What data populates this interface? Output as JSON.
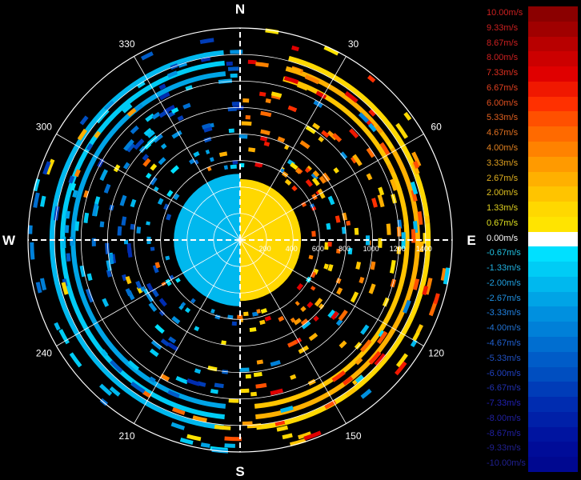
{
  "chart_data": {
    "type": "polar-radial-velocity",
    "title": "",
    "cardinals": {
      "north": "N",
      "east": "E",
      "south": "S",
      "west": "W"
    },
    "angle_ticks": [
      {
        "angle": 30,
        "label": "30"
      },
      {
        "angle": 60,
        "label": "60"
      },
      {
        "angle": 120,
        "label": "120"
      },
      {
        "angle": 150,
        "label": "150"
      },
      {
        "angle": 210,
        "label": "210"
      },
      {
        "angle": 240,
        "label": "240"
      },
      {
        "angle": 300,
        "label": "300"
      },
      {
        "angle": 330,
        "label": "330"
      }
    ],
    "range_ticks": [
      200,
      400,
      600,
      800,
      1000,
      1200,
      1400
    ],
    "range_max": 1600,
    "colorbar": {
      "labels": [
        "10.00m/s",
        "9.33m/s",
        "8.67m/s",
        "8.00m/s",
        "7.33m/s",
        "6.67m/s",
        "6.00m/s",
        "5.33m/s",
        "4.67m/s",
        "4.00m/s",
        "3.33m/s",
        "2.67m/s",
        "2.00m/s",
        "1.33m/s",
        "0.67m/s",
        "0.00m/s",
        "-0.67m/s",
        "-1.33m/s",
        "-2.00m/s",
        "-2.67m/s",
        "-3.33m/s",
        "-4.00m/s",
        "-4.67m/s",
        "-5.33m/s",
        "-6.00m/s",
        "-6.67m/s",
        "-7.33m/s",
        "-8.00m/s",
        "-8.67m/s",
        "-9.33m/s",
        "-10.00m/s"
      ],
      "colors": [
        "#8b0000",
        "#a00000",
        "#b80000",
        "#cc0000",
        "#e00000",
        "#f01800",
        "#ff3000",
        "#ff5000",
        "#ff6a00",
        "#ff8200",
        "#ff9a00",
        "#ffb000",
        "#ffc400",
        "#ffd800",
        "#ffe400",
        "#ffffff",
        "#00e0ff",
        "#00ccf5",
        "#00b8ee",
        "#00a4e6",
        "#0090df",
        "#0080d8",
        "#006ed0",
        "#005cc8",
        "#004ec0",
        "#003cb8",
        "#002cb0",
        "#0020a8",
        "#0014a0",
        "#000c98",
        "#000890"
      ],
      "label_colors": [
        "#cc2020",
        "#cc2020",
        "#cc2020",
        "#cc2020",
        "#e03020",
        "#e04020",
        "#e05020",
        "#e06020",
        "#e07020",
        "#e08020",
        "#e0a020",
        "#e0b020",
        "#e0c020",
        "#e0d020",
        "#e0e020",
        "#ffffff",
        "#20c0e0",
        "#20b0e0",
        "#20a0e0",
        "#2090e0",
        "#2080e0",
        "#2070d0",
        "#2060d0",
        "#2050c0",
        "#2040c0",
        "#2030b0",
        "#2020b0",
        "#2020a0",
        "#2020a0",
        "#202090",
        "#202090"
      ]
    },
    "field": {
      "inner_region": {
        "r_max": 500,
        "west_half": -2.2,
        "east_half": 1.6
      },
      "rings": [
        {
          "r": 1420,
          "east_value": 1.4,
          "west_value": -2.3
        },
        {
          "r": 1340,
          "east_value": 2.4,
          "west_value": -1.6
        },
        {
          "r": 1260,
          "east_value": 1.8,
          "west_value": -2.6
        }
      ]
    },
    "grid": true
  }
}
